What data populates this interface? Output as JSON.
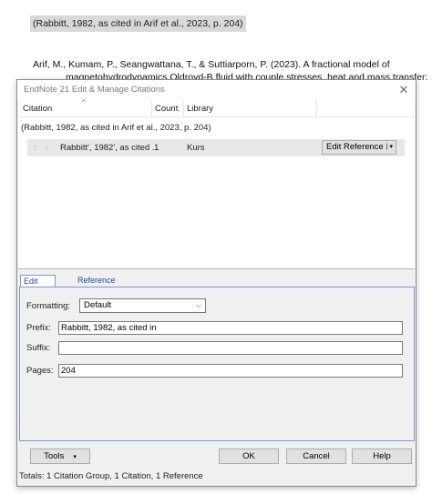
{
  "document": {
    "citation_text": "(Rabbitt, 1982, as cited in Arif et al., 2023, p. 204)",
    "reference_line1": "Arif, M., Kumam, P., Seangwattana, T., & Suttiarporn, P. (2023). A fractional model of",
    "reference_line2": "magnetohydrodynamics Oldroyd-B fluid with couple stresses, heat and mass transfer: A"
  },
  "dialog": {
    "title": "EndNote 21 Edit & Manage Citations",
    "close_glyph": "✕",
    "columns": {
      "citation": "Citation",
      "count": "Count",
      "library": "Library"
    },
    "group_text": "(Rabbitt, 1982, as cited in Arif et al., 2023, p. 204)",
    "citation_row": {
      "text": "Rabbitt', 1982', as cited ...",
      "count": "1",
      "library": "Kurs",
      "edit_reference_label": "Edit Reference"
    },
    "tabs": [
      {
        "label": "Edit Citation",
        "active": true
      },
      {
        "label": "Reference",
        "active": false
      }
    ],
    "edit_citation": {
      "formatting_label": "Formatting:",
      "formatting_value": "Default",
      "prefix_label": "Prefix:",
      "prefix_value": "Rabbitt, 1982, as cited in",
      "suffix_label": "Suffix:",
      "suffix_value": "",
      "pages_label": "Pages:",
      "pages_value": "204"
    },
    "buttons": {
      "tools": "Tools",
      "ok": "OK",
      "cancel": "Cancel",
      "help": "Help"
    },
    "status": "Totals: 1 Citation Group, 1 Citation, 1 Reference"
  },
  "colors": {
    "tab_accent": "#7a9ad6",
    "tab_text": "#1a4f99",
    "highlight": "#d9d9d9"
  }
}
